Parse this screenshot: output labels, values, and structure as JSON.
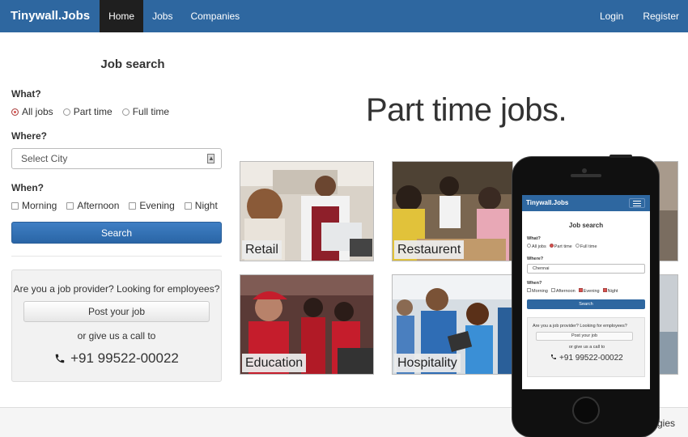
{
  "nav": {
    "brand": "Tinywall.Jobs",
    "items": [
      {
        "label": "Home",
        "active": true
      },
      {
        "label": "Jobs"
      },
      {
        "label": "Companies"
      }
    ],
    "right": [
      {
        "label": "Login"
      },
      {
        "label": "Register"
      }
    ],
    "color": "#2e67a0"
  },
  "sidebar": {
    "title": "Job search",
    "what_label": "What?",
    "what_options": [
      {
        "label": "All jobs",
        "checked": true
      },
      {
        "label": "Part time",
        "checked": false
      },
      {
        "label": "Full time",
        "checked": false
      }
    ],
    "where_label": "Where?",
    "city_placeholder": "Select City",
    "when_label": "When?",
    "when_options": [
      {
        "label": "Morning"
      },
      {
        "label": "Afternoon"
      },
      {
        "label": "Evening"
      },
      {
        "label": "Night"
      }
    ],
    "search_button": "Search",
    "provider_text": "Are you a job provider? Looking for employees?",
    "post_button": "Post your job",
    "call_text": "or give us a call to",
    "phone_number": "+91 99522-00022",
    "phone_icon": "phone-icon"
  },
  "main": {
    "headline": "Part time jobs.",
    "tiles": [
      {
        "caption": "Retail"
      },
      {
        "caption": "Restaurent"
      },
      {
        "caption": "Education"
      },
      {
        "caption": "Hospitality"
      }
    ]
  },
  "footer": {
    "text": "ogies"
  },
  "mobile": {
    "brand": "Tinywall.Jobs",
    "title": "Job search",
    "what_label": "What?",
    "what_options": [
      {
        "label": "All jobs",
        "checked": false
      },
      {
        "label": "Part time",
        "checked": true
      },
      {
        "label": "Full time",
        "checked": false
      }
    ],
    "where_label": "Where?",
    "city_value": "Chennai",
    "when_label": "When?",
    "when_options": [
      {
        "label": "Morning",
        "checked": false
      },
      {
        "label": "Afternoon",
        "checked": false
      },
      {
        "label": "Evening",
        "checked": true
      },
      {
        "label": "Night",
        "checked": true
      }
    ],
    "search_button": "Search",
    "provider_text": "Are you a job provider? Looking for employees?",
    "post_button": "Post your job",
    "call_text": "or give us a call to",
    "phone_number": "+91 99522-00022"
  }
}
